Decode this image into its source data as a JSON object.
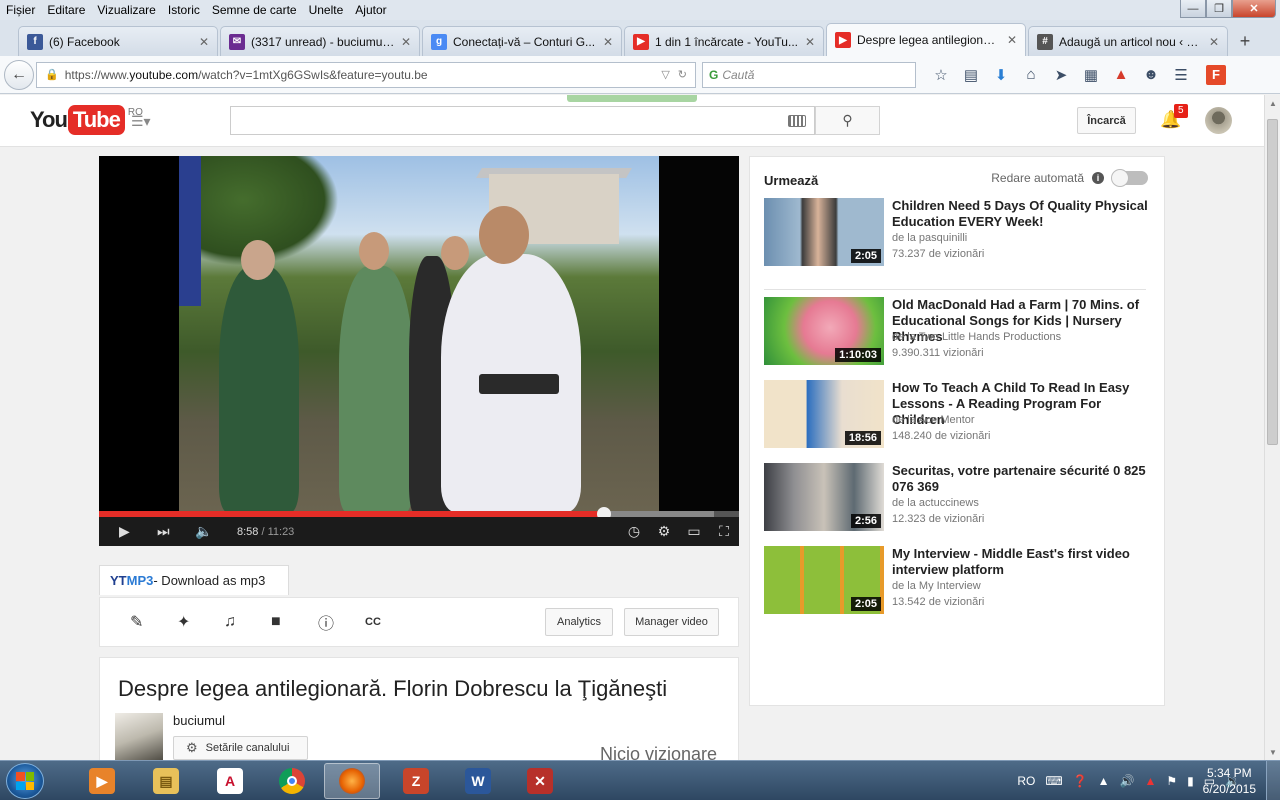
{
  "browser": {
    "menu": [
      "Fișier",
      "Editare",
      "Vizualizare",
      "Istoric",
      "Semne de carte",
      "Unelte",
      "Ajutor"
    ],
    "tabs": [
      {
        "title": "(6) Facebook",
        "icon": "facebook-icon",
        "color": "#3b5998",
        "glyph": "f",
        "active": false
      },
      {
        "title": "(3317 unread) - buciumul...",
        "icon": "mail-icon",
        "color": "#6b2c91",
        "glyph": "✉",
        "active": false
      },
      {
        "title": "Conectați-vă – Conturi G...",
        "icon": "google-icon",
        "color": "#4a8af4",
        "glyph": "g",
        "active": false
      },
      {
        "title": "1 din 1 încărcate - YouTu...",
        "icon": "youtube-icon",
        "color": "#e52d27",
        "glyph": "▶",
        "active": false
      },
      {
        "title": "Despre legea antilegionar...",
        "icon": "youtube-icon",
        "color": "#e52d27",
        "glyph": "▶",
        "active": true
      },
      {
        "title": "Adaugă un articol nou ‹ B...",
        "icon": "wordpress-icon",
        "color": "#555555",
        "glyph": "#",
        "active": false
      }
    ],
    "url_prefix": "https://www.",
    "url_host": "youtube.com",
    "url_rest": "/watch?v=1mtXg6GSwIs&feature=youtu.be",
    "search_placeholder": "Caută"
  },
  "youtube": {
    "logo_you": "You",
    "logo_tube": "Tube",
    "region": "RO",
    "upload_label": "Încarcă",
    "notification_count": "5",
    "player": {
      "current_time": "8:58",
      "duration": " / 11:23",
      "progress": 0.7886
    },
    "ytmp3": {
      "yt": "YT",
      "mp3": "MP3",
      "rest": " - Download as mp3"
    },
    "analytics_label": "Analytics",
    "video_manager_label": "Manager video",
    "video_title": "Despre legea antilegionară. Florin Dobrescu la Ţigăneşti",
    "channel_name": "buciumul",
    "channel_settings_label": "Setările canalului",
    "views": "Nicio vizionare",
    "sidebar": {
      "up_next": "Urmează",
      "autoplay": "Redare automată",
      "items": [
        {
          "title": "Children Need 5 Days Of Quality Physical Education EVERY Week!",
          "channel": "de la pasquinilli",
          "views": "73.237 de vizionări",
          "duration": "2:05"
        },
        {
          "title": "Old MacDonald Had a Farm | 70 Mins. of Educational Songs for Kids | Nursery Rhymes",
          "channel": "de la Two Little Hands Productions",
          "views": "9.390.311 vizionări",
          "duration": "1:10:03"
        },
        {
          "title": "How To Teach A Child To Read In Easy Lessons - A Reading Program For Children",
          "channel": "de la Ace Mentor",
          "views": "148.240 de vizionări",
          "duration": "18:56"
        },
        {
          "title": "Securitas, votre partenaire sécurité 0 825 076 369",
          "channel": "de la actuccinews",
          "views": "12.323 de vizionări",
          "duration": "2:56"
        },
        {
          "title": "My Interview - Middle East's first video interview platform",
          "channel": "de la My Interview",
          "views": "13.542 de vizionări",
          "duration": "2:05"
        }
      ]
    }
  },
  "taskbar": {
    "language": "RO",
    "time": "5:34 PM",
    "date": "6/20/2015"
  }
}
